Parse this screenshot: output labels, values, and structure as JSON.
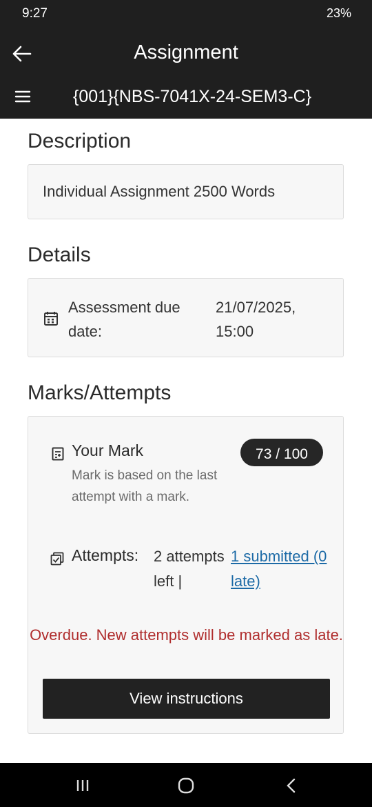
{
  "status_bar": {
    "time": "9:27",
    "battery": "23%"
  },
  "header": {
    "title": "Assignment",
    "subtitle": "{001}{NBS-7041X-24-SEM3-C}"
  },
  "description": {
    "heading": "Description",
    "text": "Individual Assignment 2500 Words"
  },
  "details": {
    "heading": "Details",
    "due_label": "Assessment due date:",
    "due_value": "21/07/2025, 15:00"
  },
  "marks": {
    "heading": "Marks/Attempts",
    "your_mark_label": "Your Mark",
    "mark_note": "Mark is based on the last attempt with a mark.",
    "mark_value": "73 / 100",
    "attempts_label": "Attempts:",
    "attempts_left": "2 attempts left |",
    "attempts_submitted": "1 submitted (0 late)",
    "overdue_message": "Overdue. New attempts will be marked as late.",
    "view_instructions_label": "View instructions"
  },
  "icons": {
    "back": "arrow-left-icon",
    "menu": "hamburger-menu-icon",
    "calendar": "calendar-icon",
    "mark": "grade-sheet-icon",
    "attempts": "checkbox-stack-icon"
  },
  "colors": {
    "header_bg": "#1f1f1f",
    "overdue": "#b02e2e",
    "link": "#1c6aa6",
    "button_bg": "#222222"
  }
}
